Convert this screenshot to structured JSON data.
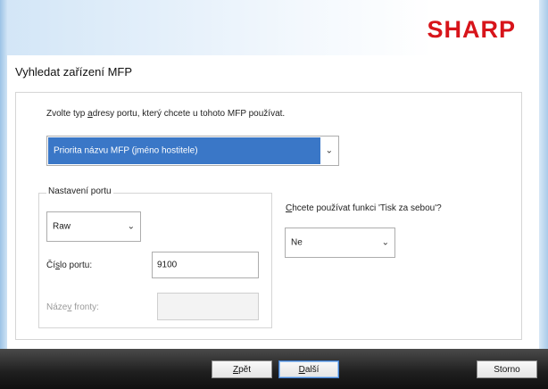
{
  "brand": {
    "logo": "SHARP",
    "accent_color": "#d7141a"
  },
  "page": {
    "title": "Vyhledat zařízení MFP"
  },
  "instruction": {
    "pre": "Zvolte typ ",
    "underlined": "a",
    "post": "dresy portu, který chcete u tohoto MFP používat."
  },
  "address_type": {
    "selected": "Priorita názvu MFP (jméno hostitele)"
  },
  "port_settings": {
    "group_label": "Nastavení portu",
    "protocol_selected": "Raw",
    "port_number_label_pre": "Čí",
    "port_number_label_underlined": "s",
    "port_number_label_post": "lo portu:",
    "port_number_value": "9100",
    "queue_label_pre": "Náze",
    "queue_label_underlined": "v",
    "queue_label_post": " fronty:",
    "queue_value": ""
  },
  "tandem": {
    "label_underlined": "C",
    "label_post": "hcete používat funkci 'Tisk za sebou'?",
    "selected": "Ne"
  },
  "buttons": {
    "back_underlined": "Z",
    "back_post": "pět",
    "next_underlined": "D",
    "next_post": "alší",
    "cancel": "Storno"
  },
  "icons": {
    "dropdown": "chevron-down-icon"
  }
}
